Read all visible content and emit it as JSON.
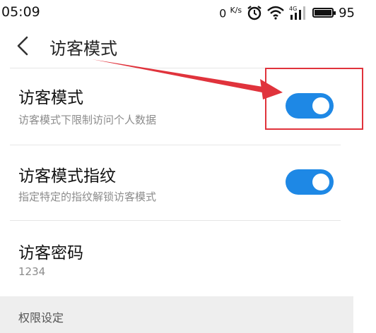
{
  "status_bar": {
    "time": "05:09",
    "speed_value": "0",
    "speed_unit": "K/s",
    "battery_level": "95",
    "icons": [
      "alarm-icon",
      "wifi-icon",
      "signal-4g-icon",
      "battery-icon"
    ]
  },
  "header": {
    "title": "访客模式",
    "back_icon": "chevron-left-icon"
  },
  "settings": {
    "guest_mode": {
      "title": "访客模式",
      "subtitle": "访客模式下限制访问个人数据",
      "enabled": true
    },
    "guest_fingerprint": {
      "title": "访客模式指纹",
      "subtitle": "指定特定的指纹解锁访客模式",
      "enabled": true
    },
    "guest_password": {
      "title": "访客密码",
      "value": "1234"
    }
  },
  "section": {
    "permissions_label": "权限设定"
  },
  "colors": {
    "toggle_on": "#1e88e5",
    "annotation": "#e0333c",
    "section_bg": "#eeeeee"
  }
}
